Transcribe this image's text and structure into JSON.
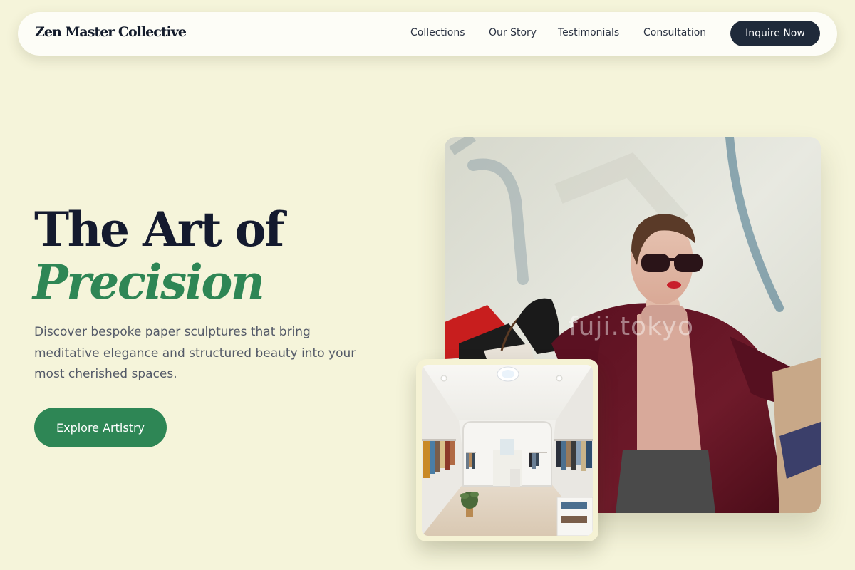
{
  "brand": {
    "name": "Zen Master Collective"
  },
  "nav": {
    "links": [
      "Collections",
      "Our Story",
      "Testimonials",
      "Consultation"
    ],
    "cta_label": "Inquire Now"
  },
  "hero": {
    "title_line1": "The Art of",
    "title_line2": "Precision",
    "description": "Discover bespoke paper sculptures that bring meditative elegance and structured beauty into your most cherished spaces.",
    "button_label": "Explore Artistry"
  },
  "images": {
    "main_watermark": "fuji.tokyo"
  },
  "colors": {
    "background": "#f5f4da",
    "accent_green": "#2e8655",
    "navy": "#1f2a3a"
  }
}
